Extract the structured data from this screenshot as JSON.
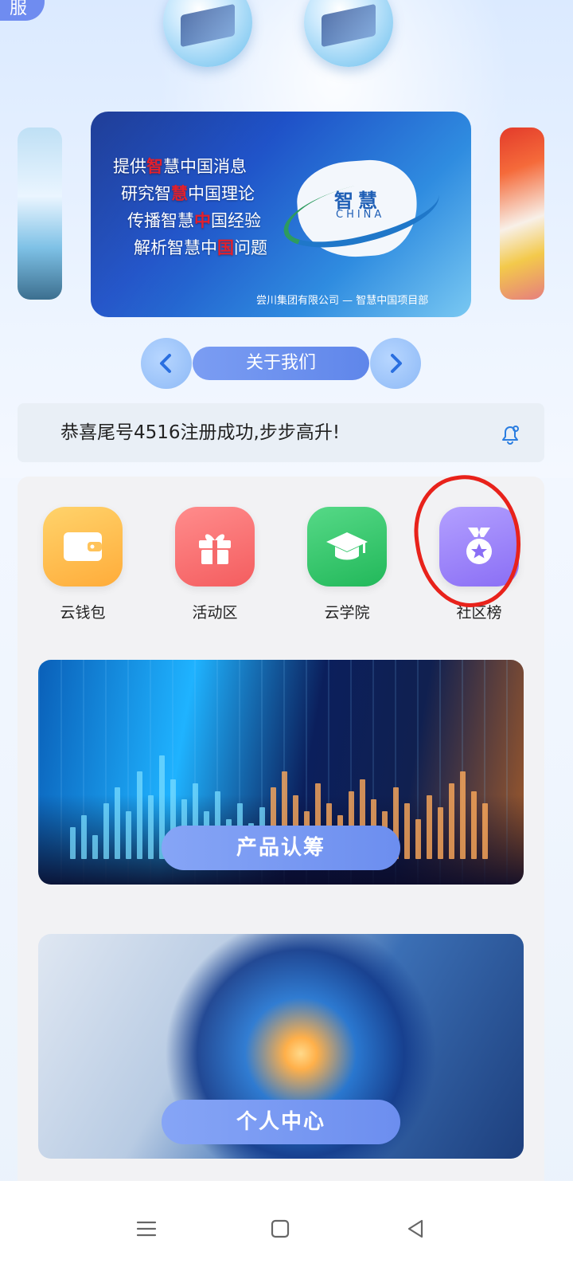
{
  "top": {
    "tab_label": "服"
  },
  "banner": {
    "lines": [
      {
        "pre": "提供",
        "hl": "智",
        "post": "慧中国消息"
      },
      {
        "pre": "研究智",
        "hl": "慧",
        "post": "中国理论"
      },
      {
        "pre": "传播智慧",
        "hl": "中",
        "post": "国经验"
      },
      {
        "pre": "解析智慧中",
        "hl": "国",
        "post": "问题"
      }
    ],
    "logo_cn": "智慧",
    "logo_en": "CHINA",
    "footer": "尝川集团有限公司 — 智慧中国项目部"
  },
  "carousel": {
    "about_label": "关于我们"
  },
  "notice": {
    "text": "恭喜尾号4516注册成功,步步高升!"
  },
  "quick_menu": [
    {
      "label": "云钱包",
      "icon": "wallet-icon"
    },
    {
      "label": "活动区",
      "icon": "gift-icon"
    },
    {
      "label": "云学院",
      "icon": "graduation-cap-icon"
    },
    {
      "label": "社区榜",
      "icon": "medal-icon"
    }
  ],
  "cards": {
    "product_label": "产品认筹",
    "center_label": "个人中心"
  },
  "colors": {
    "accent": "#6c8eef",
    "annotation": "#e8221b"
  }
}
